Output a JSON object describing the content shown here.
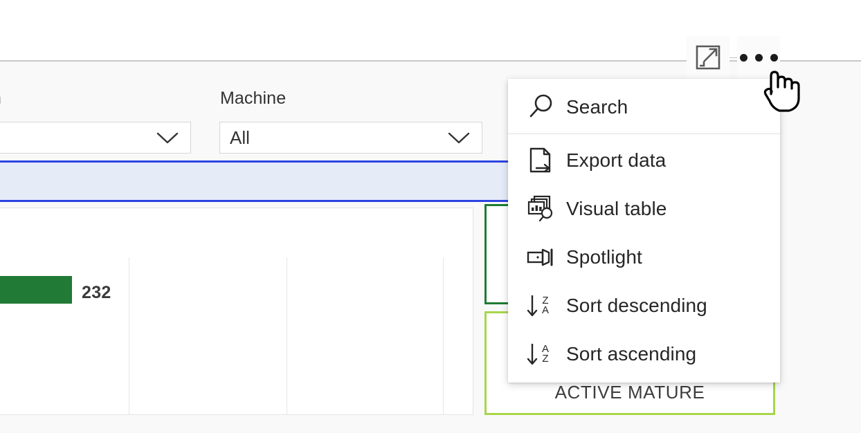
{
  "visual_header": {
    "focus_mode_icon": "expand-focus-icon",
    "more_options_icon": "more-options-ellipsis-icon"
  },
  "slicers": [
    {
      "name": "slicer-truncated",
      "label": "n",
      "value": "",
      "chevron_icon": "chevron-down-icon"
    },
    {
      "name": "slicer-machine",
      "label": "Machine",
      "value": "All",
      "chevron_icon": "chevron-down-icon"
    }
  ],
  "chart_data": {
    "type": "bar",
    "title": "",
    "xlabel": "",
    "ylabel": "",
    "categories": [
      ""
    ],
    "values": [
      232
    ],
    "data_labels": [
      "232"
    ],
    "bar_color": "#217a35",
    "grid": true,
    "orientation": "horizontal"
  },
  "kpi_cards": [
    {
      "name": "kpi-card-dark-green",
      "label": "",
      "border_color": "#1e7b34"
    },
    {
      "name": "kpi-card-active-mature",
      "label": "ACTIVE MATURE",
      "border_color": "#a7d64b"
    }
  ],
  "selection_band": {
    "name": "selected-row-highlight",
    "fill": "#e6ebf8",
    "border": "#2b44e0"
  },
  "context_menu": {
    "items": [
      {
        "label": "Search",
        "icon": "search-icon"
      },
      {
        "label": "Export data",
        "icon": "export-data-icon"
      },
      {
        "label": "Visual table",
        "icon": "visual-table-icon"
      },
      {
        "label": "Spotlight",
        "icon": "spotlight-icon"
      },
      {
        "label": "Sort descending",
        "icon": "sort-descending-icon",
        "sort_top": "Z",
        "sort_bottom": "A"
      },
      {
        "label": "Sort ascending",
        "icon": "sort-ascending-icon",
        "sort_top": "A",
        "sort_bottom": "Z"
      }
    ]
  },
  "cursor": {
    "name": "hand-pointer-cursor"
  }
}
